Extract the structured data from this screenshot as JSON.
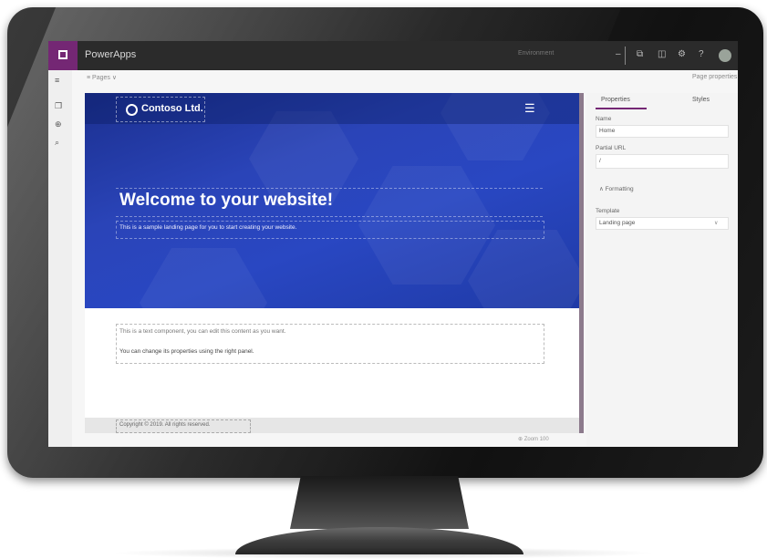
{
  "app": {
    "title": "PowerApps",
    "environment": "Environment",
    "avatar_color": "#9aa39a"
  },
  "toolbar_icons": [
    "minus-icon",
    "copy-icon",
    "help-icon",
    "settings-icon",
    "question-icon"
  ],
  "left_rail": {
    "icons": [
      "pages-icon",
      "settings-icon",
      "search-icon"
    ]
  },
  "command_bar": {
    "pages_label": "≡ Pages ∨",
    "right_label": "Page properties"
  },
  "hero": {
    "logo_text": "Contoso Ltd.",
    "headline": "Welcome to your website!",
    "subline": "This is a sample landing page for you to start creating your website."
  },
  "body": {
    "line1": "This is a text component, you can edit this content as you want.",
    "line2": "You can change its properties using the right panel."
  },
  "footer": {
    "text": "Copyright © 2019. All rights reserved."
  },
  "status": {
    "text": "⊕ Zoom  100"
  },
  "properties_panel": {
    "tabs": [
      "Properties",
      "Styles"
    ],
    "name_label": "Name",
    "name_value": "Home",
    "url_label": "Partial URL",
    "url_value": "/",
    "formatting_label": "∧  Formatting",
    "template_label": "Template",
    "template_value": "Landing page"
  },
  "colors": {
    "accent": "#742774",
    "hero_blue": "#2947c2",
    "titlebar": "#2b2b2b"
  }
}
